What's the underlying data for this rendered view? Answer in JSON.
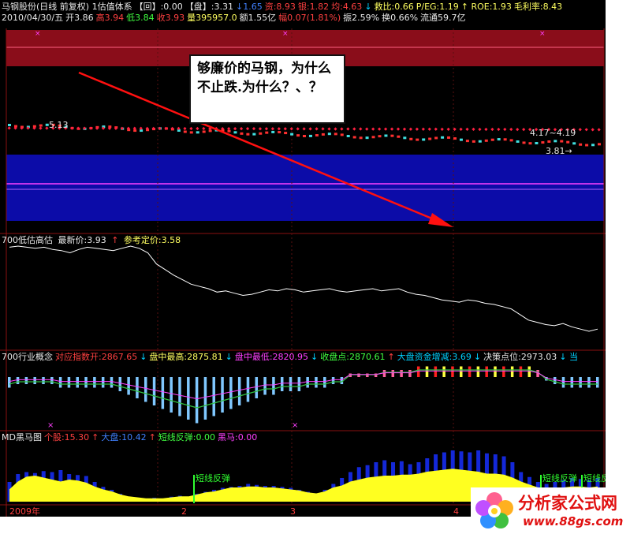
{
  "header": {
    "line1": [
      {
        "text": "马钢股份(日线 前复权) 1估值体系",
        "color": "#e8e8e8"
      },
      {
        "text": "【回】:0.00",
        "color": "#e8e8e8"
      },
      {
        "text": "【盘】:3.31",
        "color": "#e8e8e8"
      },
      {
        "text": "↓1.65",
        "color": "#4080ff"
      },
      {
        "text": "资:8.93",
        "color": "#ff4040"
      },
      {
        "text": "银:1.82",
        "color": "#ff4040"
      },
      {
        "text": "均:4.63",
        "color": "#ff4040"
      },
      {
        "text": "↓",
        "color": "#00d0ff"
      },
      {
        "text": "救比:0.66",
        "color": "#ffff60"
      },
      {
        "text": "P/EG:1.19",
        "color": "#ffff60"
      },
      {
        "text": "↑ ROE:1.93",
        "color": "#ffff60"
      },
      {
        "text": "毛利率:8.43",
        "color": "#ffff60"
      }
    ],
    "line2": [
      {
        "text": "2010/04/30/五",
        "color": "#e8e8e8"
      },
      {
        "text": "开3.86",
        "color": "#e8e8e8"
      },
      {
        "text": "高3.94",
        "color": "#ff4040"
      },
      {
        "text": "低3.84",
        "color": "#40ff40"
      },
      {
        "text": "收3.93",
        "color": "#ff4040"
      },
      {
        "text": "量395957.0",
        "color": "#ffff60"
      },
      {
        "text": "额1.55亿",
        "color": "#e8e8e8"
      },
      {
        "text": "幅0.07(1.81%)",
        "color": "#ff4040"
      },
      {
        "text": "振2.59%",
        "color": "#e8e8e8"
      },
      {
        "text": "换0.66%",
        "color": "#e8e8e8"
      },
      {
        "text": "流通59.7亿",
        "color": "#e8e8e8"
      }
    ]
  },
  "main_panel": {
    "price_label_left": "5.13",
    "price_label_right": "4.17~4.19",
    "price_label_arrow": "3.81→"
  },
  "callout": {
    "text": "够廉价的马钢，为什么不止跌.为什么？、？"
  },
  "panel2": {
    "name": "700低估高估",
    "latest_label": "最新价:3.93",
    "latest_arrow": "↑",
    "ref_label": "参考定价:3.58",
    "line_values": [
      3.95,
      3.96,
      3.95,
      3.94,
      3.95,
      3.93,
      3.92,
      3.9,
      3.93,
      3.95,
      3.94,
      3.93,
      3.92,
      3.94,
      3.96,
      3.94,
      3.9,
      3.8,
      3.75,
      3.7,
      3.66,
      3.62,
      3.6,
      3.58,
      3.55,
      3.56,
      3.54,
      3.52,
      3.53,
      3.55,
      3.57,
      3.56,
      3.58,
      3.57,
      3.55,
      3.56,
      3.57,
      3.58,
      3.56,
      3.55,
      3.56,
      3.57,
      3.58,
      3.56,
      3.57,
      3.58,
      3.55,
      3.53,
      3.52,
      3.5,
      3.48,
      3.47,
      3.46,
      3.48,
      3.47,
      3.45,
      3.44,
      3.42,
      3.4,
      3.35,
      3.3,
      3.28,
      3.26,
      3.25,
      3.27,
      3.24,
      3.22,
      3.2,
      3.22
    ]
  },
  "panel3": {
    "items": [
      {
        "text": "700行业概念",
        "color": "#e8e8e8"
      },
      {
        "text": "对应指数开:2867.65",
        "color": "#ff4040"
      },
      {
        "text": "↓",
        "color": "#00d0ff"
      },
      {
        "text": "盘中最高:2875.81",
        "color": "#ffff60"
      },
      {
        "text": "↓",
        "color": "#00d0ff"
      },
      {
        "text": "盘中最低:2820.95",
        "color": "#ff40ff"
      },
      {
        "text": "↓",
        "color": "#00d0ff"
      },
      {
        "text": "收盘点:2870.61",
        "color": "#40ff40"
      },
      {
        "text": "↑",
        "color": "#ff4040"
      },
      {
        "text": "大盘资金增减:3.69",
        "color": "#00d0ff"
      },
      {
        "text": "↓",
        "color": "#00d0ff"
      },
      {
        "text": "决策点位:2973.03",
        "color": "#e8e8e8"
      },
      {
        "text": "↓ 当",
        "color": "#00d0ff"
      }
    ],
    "bar_values": [
      3,
      2,
      2,
      2,
      2,
      2,
      3,
      3,
      3,
      3,
      3,
      3,
      3,
      4,
      5,
      6,
      7,
      8,
      9,
      10,
      11,
      12,
      13,
      12,
      11,
      10,
      9,
      8,
      7,
      6,
      5,
      5,
      4,
      4,
      4,
      3,
      3,
      3,
      2,
      2,
      -1,
      -1,
      -1,
      -1,
      -2,
      -2,
      -2,
      -2,
      -3,
      -3,
      -3,
      -3,
      -3,
      -3,
      -3,
      -3,
      -3,
      -3,
      -3,
      -3,
      -3,
      -3,
      -2,
      1,
      2,
      3,
      3,
      3,
      3,
      3
    ]
  },
  "panel4": {
    "items": [
      {
        "text": "MD黑马图",
        "color": "#e8e8e8"
      },
      {
        "text": "个股:15.30",
        "color": "#ff4040"
      },
      {
        "text": "↑",
        "color": "#ff4040"
      },
      {
        "text": "大盘:10.42",
        "color": "#4080ff"
      },
      {
        "text": "↑",
        "color": "#ff4040"
      },
      {
        "text": "短线反弹:0.00",
        "color": "#40ff40"
      },
      {
        "text": "黑马:0.00",
        "color": "#ff40ff"
      }
    ],
    "signal_label": "短线反弹",
    "stock_values": [
      20,
      28,
      30,
      29,
      31,
      30,
      32,
      28,
      27,
      26,
      20,
      15,
      12,
      8,
      5,
      4,
      3,
      4,
      3,
      5,
      6,
      5,
      8,
      10,
      12,
      14,
      15,
      16,
      18,
      17,
      16,
      16,
      15,
      14,
      12,
      10,
      8,
      12,
      18,
      24,
      30,
      35,
      37,
      40,
      42,
      40,
      41,
      38,
      40,
      44,
      48,
      50,
      52,
      51,
      50,
      52,
      49,
      48,
      46,
      40,
      30,
      25,
      20,
      18,
      20,
      22,
      24,
      23,
      22,
      24
    ],
    "market_values": [
      12,
      20,
      25,
      26,
      24,
      22,
      20,
      22,
      21,
      19,
      15,
      12,
      10,
      7,
      5,
      4,
      3,
      3,
      3,
      4,
      5,
      5,
      7,
      9,
      10,
      12,
      14,
      14,
      15,
      15,
      14,
      14,
      13,
      12,
      11,
      9,
      8,
      10,
      14,
      16,
      20,
      22,
      24,
      25,
      26,
      26,
      27,
      27,
      28,
      30,
      31,
      32,
      33,
      32,
      31,
      30,
      28,
      28,
      27,
      24,
      20,
      17,
      14,
      13,
      13,
      14,
      15,
      15,
      14,
      15
    ]
  },
  "xaxis": {
    "labels": [
      "2009年",
      "2",
      "3",
      "4"
    ]
  },
  "logo": {
    "title": "分析家公式网",
    "url": "www.88gs.com"
  }
}
